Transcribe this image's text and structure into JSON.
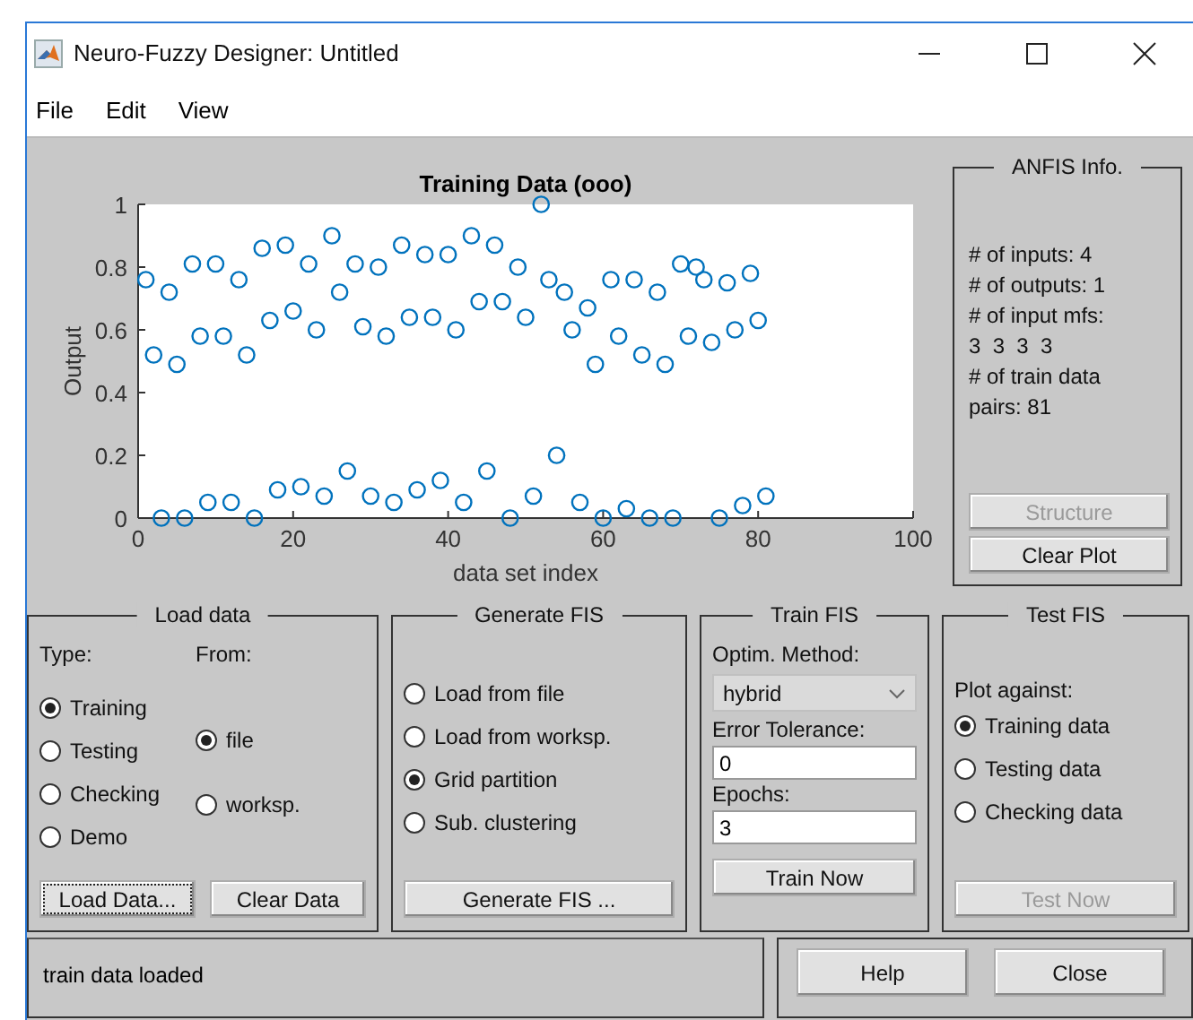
{
  "window": {
    "title": "Neuro-Fuzzy Designer: Untitled",
    "menu": [
      "File",
      "Edit",
      "View"
    ]
  },
  "plot": {
    "chart_data": {
      "type": "scatter",
      "title": "Training Data (ooo)",
      "xlabel": "data set index",
      "ylabel": "Output",
      "x": [
        1,
        2,
        3,
        4,
        5,
        6,
        7,
        8,
        9,
        10,
        11,
        12,
        13,
        14,
        15,
        16,
        17,
        18,
        19,
        20,
        21,
        22,
        23,
        24,
        25,
        26,
        27,
        28,
        29,
        30,
        31,
        32,
        33,
        34,
        35,
        36,
        37,
        38,
        39,
        40,
        41,
        42,
        43,
        44,
        45,
        46,
        47,
        48,
        49,
        50,
        51,
        52,
        53,
        54,
        55,
        56,
        57,
        58,
        59,
        60,
        61,
        62,
        63,
        64,
        65,
        66,
        67,
        68,
        69,
        70,
        71,
        72,
        73,
        74,
        75,
        76,
        77,
        78,
        79,
        80,
        81
      ],
      "values": [
        0.76,
        0.52,
        0,
        0.72,
        0.49,
        0,
        0.81,
        0.58,
        0.05,
        0.81,
        0.58,
        0.05,
        0.76,
        0.52,
        0,
        0.86,
        0.63,
        0.09,
        0.87,
        0.66,
        0.1,
        0.81,
        0.6,
        0.07,
        0.9,
        0.72,
        0.15,
        0.81,
        0.61,
        0.07,
        0.8,
        0.58,
        0.05,
        0.87,
        0.64,
        0.09,
        0.84,
        0.64,
        0.12,
        0.84,
        0.6,
        0.05,
        0.9,
        0.69,
        0.15,
        0.87,
        0.69,
        0,
        0.8,
        0.64,
        0.07,
        1,
        0.76,
        0.2,
        0.72,
        0.6,
        0.05,
        0.67,
        0.49,
        0,
        0.76,
        0.58,
        0.03,
        0.76,
        0.52,
        0,
        0.72,
        0.49,
        0,
        0.81,
        0.58,
        0.8,
        0.76,
        0.56,
        0,
        0.75,
        0.6,
        0.04,
        0.78,
        0.63,
        0.07
      ],
      "xlim": [
        0,
        100
      ],
      "ylim": [
        0,
        1
      ],
      "xticks": [
        0,
        20,
        40,
        60,
        80,
        100
      ],
      "yticks": [
        0,
        0.2,
        0.4,
        0.6,
        0.8,
        1
      ]
    }
  },
  "anfis_info": {
    "title": "ANFIS Info.",
    "lines": [
      "# of inputs: 4",
      "# of outputs: 1",
      "# of input mfs:",
      "3  3  3  3",
      "# of train data",
      "pairs: 81"
    ],
    "buttons": [
      {
        "label": "Structure",
        "disabled": true
      },
      {
        "label": "Clear Plot",
        "disabled": false
      }
    ]
  },
  "load_data": {
    "title": "Load data",
    "type_label": "Type:",
    "from_label": "From:",
    "type_options": [
      {
        "label": "Training",
        "selected": true
      },
      {
        "label": "Testing",
        "selected": false
      },
      {
        "label": "Checking",
        "selected": false
      },
      {
        "label": "Demo",
        "selected": false
      }
    ],
    "from_options": [
      {
        "label": "file",
        "selected": true
      },
      {
        "label": "worksp.",
        "selected": false
      }
    ],
    "buttons": [
      {
        "label": "Load Data...",
        "focused": true
      },
      {
        "label": "Clear Data",
        "focused": false
      }
    ]
  },
  "generate_fis": {
    "title": "Generate FIS",
    "options": [
      {
        "label": "Load from file",
        "selected": false
      },
      {
        "label": "Load from worksp.",
        "selected": false
      },
      {
        "label": "Grid partition",
        "selected": true
      },
      {
        "label": "Sub. clustering",
        "selected": false
      }
    ],
    "button": "Generate FIS ..."
  },
  "train_fis": {
    "title": "Train FIS",
    "method_label": "Optim. Method:",
    "method": "hybrid",
    "tolerance_label": "Error Tolerance:",
    "tolerance": "0",
    "epochs_label": "Epochs:",
    "epochs": "3",
    "button": "Train Now"
  },
  "test_fis": {
    "title": "Test FIS",
    "plot_label": "Plot against:",
    "options": [
      {
        "label": "Training data",
        "selected": true
      },
      {
        "label": "Testing data",
        "selected": false
      },
      {
        "label": "Checking data",
        "selected": false
      }
    ],
    "button": {
      "label": "Test Now",
      "disabled": true
    }
  },
  "status": "train data loaded",
  "footer_buttons": [
    "Help",
    "Close"
  ]
}
